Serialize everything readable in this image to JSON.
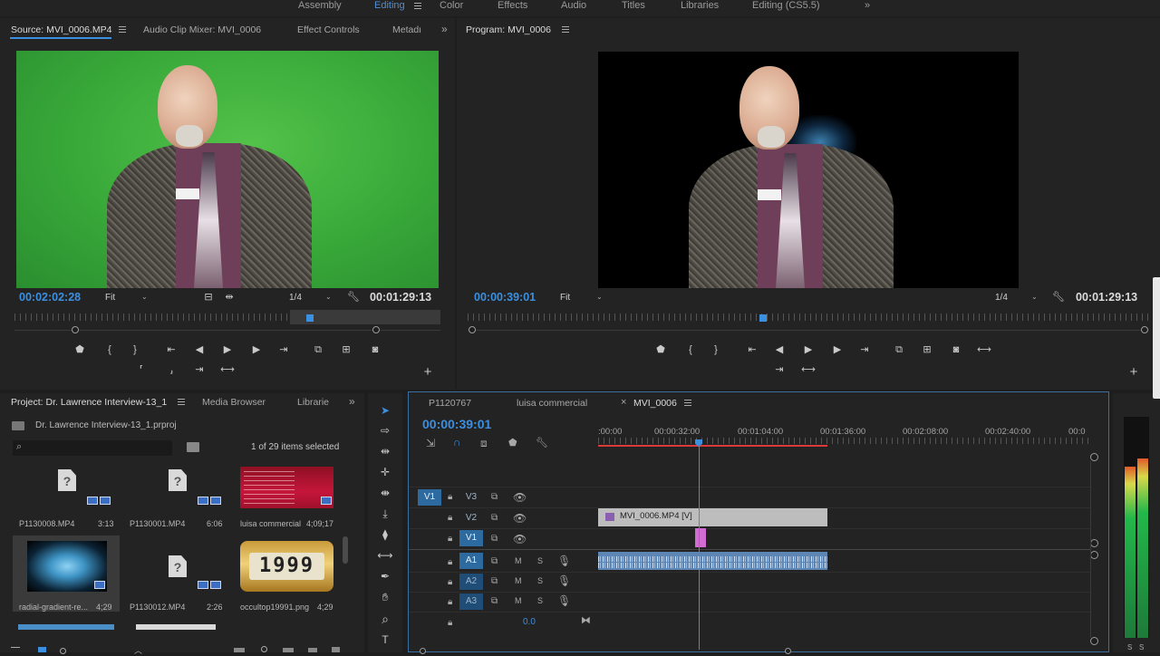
{
  "workspaces": {
    "tabs": [
      "Assembly",
      "Editing",
      "Color",
      "Effects",
      "Audio",
      "Titles",
      "Libraries",
      "Editing (CS5.5)"
    ],
    "active": "Editing",
    "overflow": "»"
  },
  "source_monitor": {
    "tabs": [
      "Source: MVI_0006.MP4",
      "Audio Clip Mixer: MVI_0006",
      "Effect Controls",
      "Metadata"
    ],
    "tab_metadata_visible": "Metadı",
    "timecode_in": "00:02:02:28",
    "timecode_duration": "00:01:29:13",
    "zoom": "Fit",
    "resolution": "1/4"
  },
  "program_monitor": {
    "tab": "Program: MVI_0006",
    "timecode_in": "00:00:39:01",
    "timecode_duration": "00:01:29:13",
    "zoom": "Fit",
    "resolution": "1/4"
  },
  "project_panel": {
    "tabs": [
      "Project: Dr. Lawrence Interview-13_1",
      "Media Browser",
      "Librarie"
    ],
    "path": "Dr. Lawrence Interview-13_1.prproj",
    "search_placeholder": "",
    "selection": "1 of 29 items selected",
    "items": [
      {
        "name": "P1130008.MP4",
        "duration": "3:13",
        "type": "missing-video"
      },
      {
        "name": "P1130001.MP4",
        "duration": "6:06",
        "type": "missing-video"
      },
      {
        "name": "luisa commercial",
        "duration": "4;09;17",
        "type": "sequence-red"
      },
      {
        "name": "radial-gradient-re...",
        "duration": "4;29",
        "type": "radial-gradient"
      },
      {
        "name": "P1130012.MP4",
        "duration": "2:26",
        "type": "missing-video"
      },
      {
        "name": "occultop19991.png",
        "duration": "4;29",
        "type": "counter-image"
      }
    ],
    "counter_digits": "1999"
  },
  "timeline": {
    "tabs": [
      "P1120767",
      "luisa commercial",
      "MVI_0006"
    ],
    "active_tab": "MVI_0006",
    "timecode": "00:00:39:01",
    "ruler_labels": [
      ":00:00",
      "00:00:32:00",
      "00:01:04:00",
      "00:01:36:00",
      "00:02:08:00",
      "00:02:40:00",
      "00:0"
    ],
    "video_tracks": [
      "V3",
      "V2",
      "V1"
    ],
    "audio_tracks": [
      "A1",
      "A2",
      "A3"
    ],
    "source_patch_v": "V1",
    "source_patch_a": "A1",
    "mute_label": "M",
    "solo_label": "S",
    "master_volume": "0.0",
    "video_clip_label": "MVI_0006.MP4 [V]",
    "playhead_fraction": 0.219
  },
  "audio_meter": {
    "labels": [
      "S",
      "S"
    ],
    "level_left": 0.78,
    "level_right": 0.82
  },
  "colors": {
    "accent": "#3b8fe0",
    "green_screen": "#3aa83b",
    "audio_clip": "#5d86b5",
    "video_clip": "#bdbdbd",
    "edit_point": "#d26bd2",
    "work_area": "#d93a3a"
  }
}
